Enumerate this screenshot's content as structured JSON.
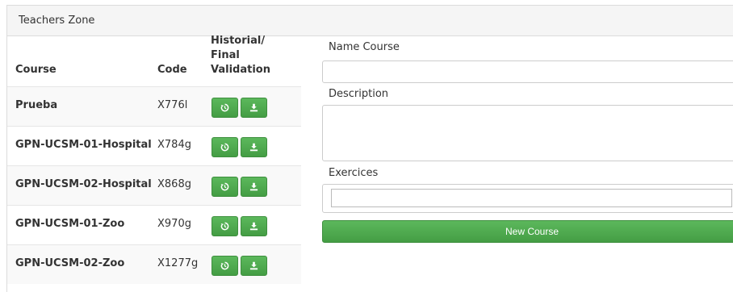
{
  "panel": {
    "title": "Teachers Zone"
  },
  "table": {
    "headers": {
      "course": "Course",
      "code": "Code",
      "historial_line1": "Historial/",
      "historial_line2": "Final Validation"
    },
    "rows": [
      {
        "course": "Prueba",
        "code": "X776l"
      },
      {
        "course": "GPN-UCSM-01-Hospital",
        "code": "X784g"
      },
      {
        "course": "GPN-UCSM-02-Hospital",
        "code": "X868g"
      },
      {
        "course": "GPN-UCSM-01-Zoo",
        "code": "X970g"
      },
      {
        "course": "GPN-UCSM-02-Zoo",
        "code": "X1277g"
      }
    ],
    "row_icons": [
      "history-icon",
      "download-icon"
    ]
  },
  "form": {
    "name_label": "Name Course",
    "name_value": "",
    "description_label": "Description",
    "description_value": "",
    "exercises_label": "Exercices",
    "new_course_label": "New Course"
  },
  "colors": {
    "button_green": "#5cb85c",
    "heading_bg": "#f5f5f5",
    "stripe_bg": "#f9f9f9"
  }
}
